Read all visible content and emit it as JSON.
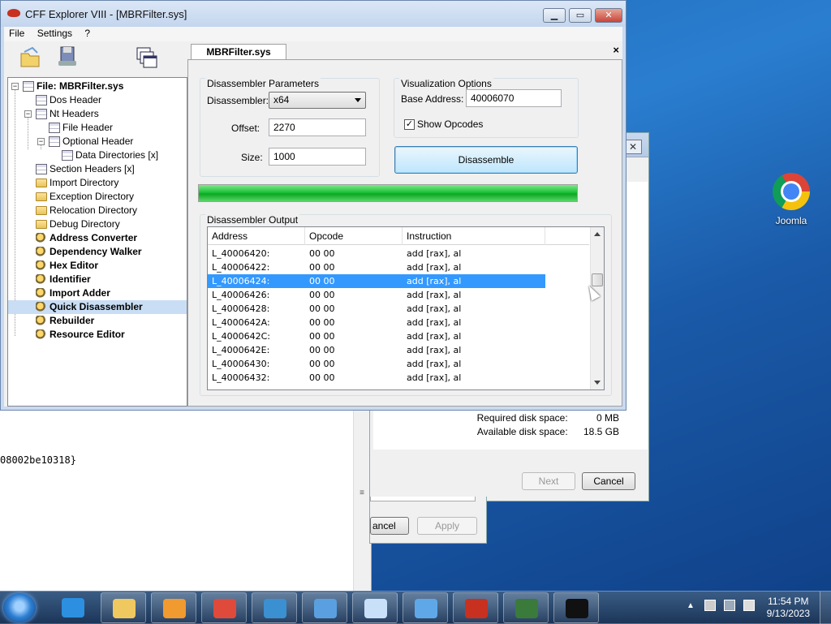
{
  "window": {
    "title": "CFF Explorer VIII - [MBRFilter.sys]",
    "menu": [
      "File",
      "Settings",
      "?"
    ]
  },
  "tree": {
    "root": "File: MBRFilter.sys",
    "items": [
      {
        "label": "Dos Header"
      },
      {
        "label": "Nt Headers"
      },
      {
        "label": "File Header"
      },
      {
        "label": "Optional Header"
      },
      {
        "label": "Data Directories [x]"
      },
      {
        "label": "Section Headers [x]"
      },
      {
        "label": "Import Directory"
      },
      {
        "label": "Exception Directory"
      },
      {
        "label": "Relocation Directory"
      },
      {
        "label": "Debug Directory"
      },
      {
        "label": "Address Converter"
      },
      {
        "label": "Dependency Walker"
      },
      {
        "label": "Hex Editor"
      },
      {
        "label": "Identifier"
      },
      {
        "label": "Import Adder"
      },
      {
        "label": "Quick Disassembler"
      },
      {
        "label": "Rebuilder"
      },
      {
        "label": "Resource Editor"
      }
    ]
  },
  "tab": {
    "label": "MBRFilter.sys",
    "close": "×"
  },
  "params": {
    "group_title": "Disassembler Parameters",
    "disassembler_label": "Disassembler:",
    "disassembler_value": "x64",
    "offset_label": "Offset:",
    "offset_value": "2270",
    "size_label": "Size:",
    "size_value": "1000"
  },
  "viz": {
    "group_title": "Visualization Options",
    "base_label": "Base Address:",
    "base_value": "40006070",
    "show_opcodes_label": "Show Opcodes",
    "show_opcodes_checked": true
  },
  "disassemble_button": "Disassemble",
  "progress": {
    "percent": 100
  },
  "output": {
    "group_title": "Disassembler Output",
    "columns": [
      "Address",
      "Opcode",
      "Instruction"
    ],
    "rows": [
      {
        "address": "L_40006420:",
        "opcode": "00 00",
        "instruction": "add [rax], al"
      },
      {
        "address": "L_40006422:",
        "opcode": "00 00",
        "instruction": "add [rax], al"
      },
      {
        "address": "L_40006424:",
        "opcode": "00 00",
        "instruction": "add [rax], al"
      },
      {
        "address": "L_40006426:",
        "opcode": "00 00",
        "instruction": "add [rax], al"
      },
      {
        "address": "L_40006428:",
        "opcode": "00 00",
        "instruction": "add [rax], al"
      },
      {
        "address": "L_4000642A:",
        "opcode": "00 00",
        "instruction": "add [rax], al"
      },
      {
        "address": "L_4000642C:",
        "opcode": "00 00",
        "instruction": "add [rax], al"
      },
      {
        "address": "L_4000642E:",
        "opcode": "00 00",
        "instruction": "add [rax], al"
      },
      {
        "address": "L_40006430:",
        "opcode": "00 00",
        "instruction": "add [rax], al"
      },
      {
        "address": "L_40006432:",
        "opcode": "00 00",
        "instruction": "add [rax], al"
      }
    ],
    "selected_index": 2
  },
  "installer": {
    "required_label": "Required disk space:",
    "required_value": "0 MB",
    "available_label": "Available disk space:",
    "available_value": "18.5 GB",
    "next": "Next",
    "cancel": "Cancel"
  },
  "propdlg": {
    "cancel": "ancel",
    "apply": "Apply"
  },
  "editor": {
    "code_line": "08002be10318}"
  },
  "desktop": {
    "chrome_label": "Joomla"
  },
  "taskbar": {
    "time": "11:54 PM",
    "date": "9/13/2023",
    "items": [
      "internet-explorer",
      "file-explorer",
      "media-player",
      "chrome",
      "network-globe",
      "network-settings",
      "notepad",
      "control-panel",
      "cff-explorer",
      "process-monitor",
      "command-prompt"
    ]
  }
}
